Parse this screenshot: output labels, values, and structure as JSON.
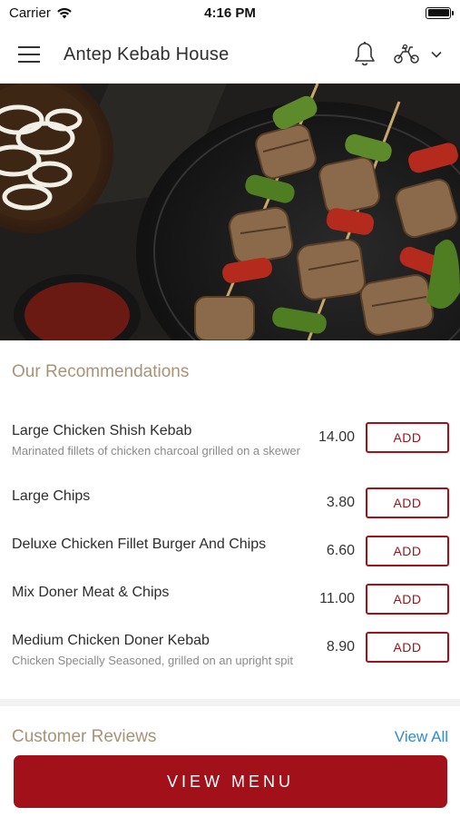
{
  "status_bar": {
    "carrier": "Carrier",
    "time": "4:16 PM",
    "battery_level": 1.0
  },
  "header": {
    "title": "Antep Kebab House",
    "icons": [
      "menu-icon",
      "bell-icon",
      "scooter-icon",
      "chevron-down-icon"
    ]
  },
  "hero": {
    "image": "chicken-shish-kebab-skewers-photo"
  },
  "recommendations": {
    "title": "Our Recommendations",
    "items": [
      {
        "name": "Large Chicken Shish Kebab",
        "description": "Marinated fillets of chicken charcoal grilled on a skewer",
        "price": "14.00",
        "button": "ADD"
      },
      {
        "name": "Large Chips",
        "description": "",
        "price": "3.80",
        "button": "ADD"
      },
      {
        "name": "Deluxe Chicken Fillet Burger And Chips",
        "description": "",
        "price": "6.60",
        "button": "ADD"
      },
      {
        "name": "Mix Doner Meat & Chips",
        "description": "",
        "price": "11.00",
        "button": "ADD"
      },
      {
        "name": "Medium Chicken Doner Kebab",
        "description": "Chicken Specially Seasoned, grilled on an upright spit",
        "price": "8.90",
        "button": "ADD"
      }
    ]
  },
  "reviews": {
    "title": "Customer Reviews",
    "view_all": "View All"
  },
  "cta": {
    "label": "VIEW MENU"
  },
  "colors": {
    "accent": "#a2101a",
    "section_title": "#a89377",
    "link": "#2e8ccf"
  }
}
